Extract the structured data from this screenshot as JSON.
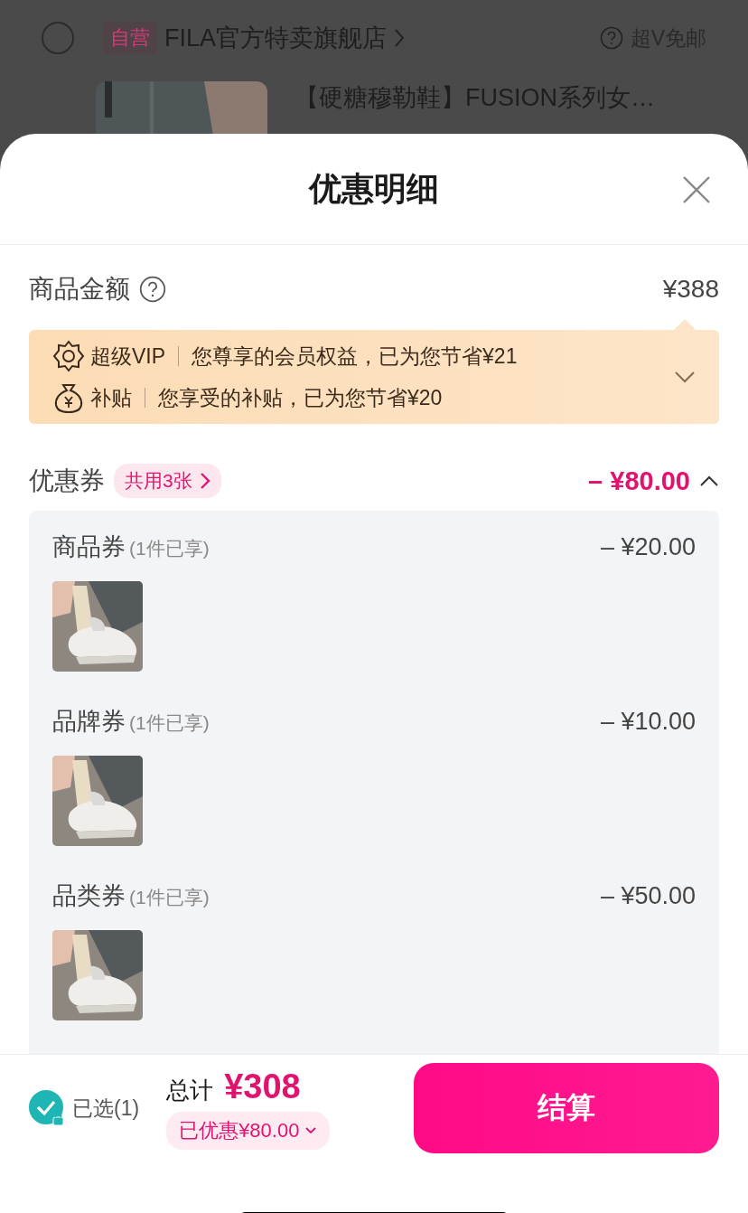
{
  "background_page": {
    "store": {
      "checked": false,
      "tag": "自营",
      "name": "FILA官方特卖旗舰店",
      "shipping": "超V免邮"
    },
    "product": {
      "title": "【硬糖穆勒鞋】FUSION系列女…"
    }
  },
  "sheet": {
    "title": "优惠明细"
  },
  "subtotal": {
    "label": "商品金额",
    "amount": "¥388"
  },
  "benefits": {
    "expanded": false,
    "items": [
      {
        "kind": "vip",
        "name": "超级VIP",
        "text": "您尊享的会员权益，已为您节省¥21"
      },
      {
        "kind": "subsidy",
        "name": "补贴",
        "text": "您享受的补贴，已为您节省¥20"
      }
    ]
  },
  "coupons": {
    "label": "优惠券",
    "badge": "共用3张",
    "amount": "– ¥80.00",
    "expanded": true,
    "items": [
      {
        "name": "商品券",
        "note": "(1件已享)",
        "amount": "– ¥20.00"
      },
      {
        "name": "品牌券",
        "note": "(1件已享)",
        "amount": "– ¥10.00"
      },
      {
        "name": "品类券",
        "note": "(1件已享)",
        "amount": "– ¥50.00"
      }
    ]
  },
  "footer": {
    "select": {
      "checked": true,
      "label": "已选(1)"
    },
    "total_label": "总计",
    "total": "¥308",
    "discount": "已优惠¥80.00",
    "checkout": "结算"
  }
}
